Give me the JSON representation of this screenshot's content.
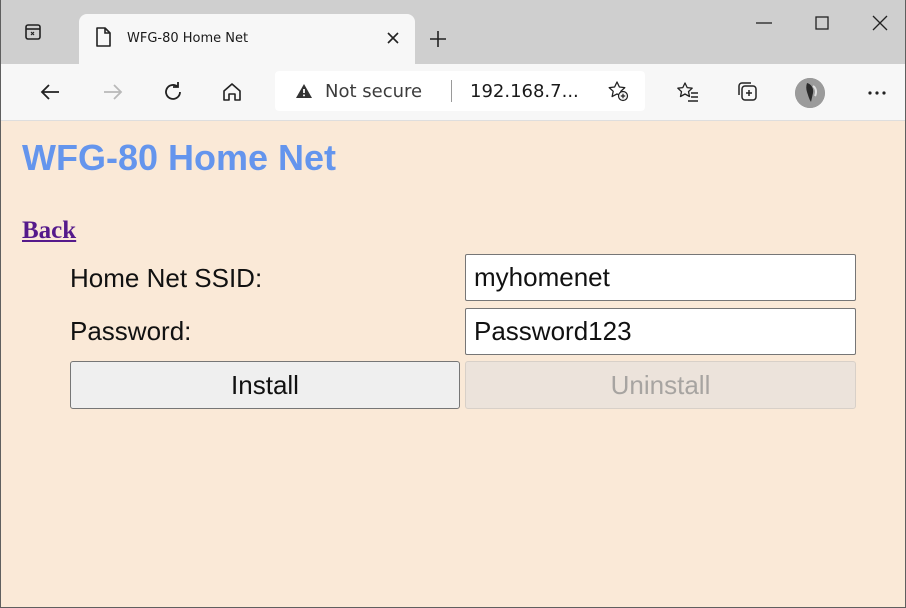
{
  "browser": {
    "tab_title": "WFG-80 Home Net",
    "address_security": "Not secure",
    "address_url": "192.168.7...",
    "icons": [
      "tab-actions-icon",
      "page-icon",
      "close-icon",
      "plus-icon",
      "minimize-icon",
      "maximize-icon",
      "close-window-icon",
      "back-icon",
      "forward-icon",
      "refresh-icon",
      "home-icon",
      "warning-icon",
      "add-favorite-icon",
      "favorites-icon",
      "collections-icon",
      "profile-avatar",
      "more-icon"
    ]
  },
  "page": {
    "heading": "WFG-80 Home Net",
    "back_link": "Back",
    "form": {
      "ssid_label": "Home Net SSID:",
      "ssid_value": "myhomenet",
      "password_label": "Password:",
      "password_value": "Password123",
      "install_label": "Install",
      "uninstall_label": "Uninstall"
    }
  },
  "colors": {
    "page_background": "#fae9d7",
    "heading": "#6495ed",
    "link": "#551a8b"
  }
}
